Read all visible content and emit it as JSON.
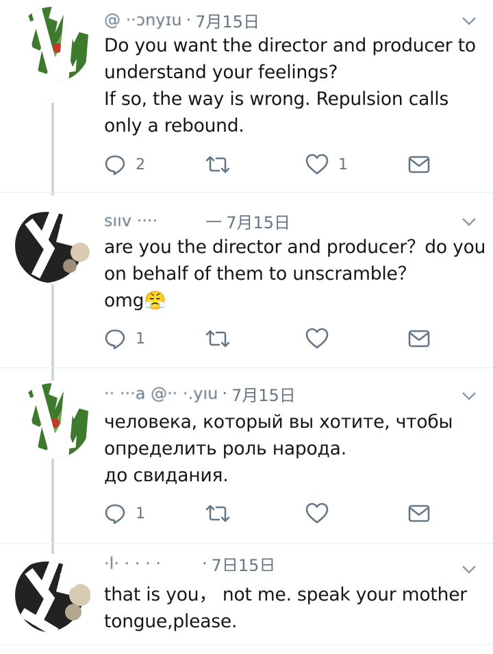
{
  "tweets": [
    {
      "handle": "@ ··ɔnyɪu",
      "date": "7月15日",
      "text": "Do you want the director and producer to understand your feelings?\nIf so, the way is wrong. Repulsion calls only a rebound.",
      "reply_count": "2",
      "retweet_count": "",
      "like_count": "1"
    },
    {
      "handle": "sııv ····",
      "date": "7月15日",
      "text": "are you the director and producer？do you on behalf of them to unscramble？\nomg😤",
      "reply_count": "1",
      "retweet_count": "",
      "like_count": ""
    },
    {
      "handle": "·· ···a @·· ·.yıu",
      "date": "7月15日",
      "text": "человека, который вы хотите, чтобы определить роль народа.\nдо свидания.",
      "reply_count": "1",
      "retweet_count": "",
      "like_count": ""
    },
    {
      "handle": "·l· · · · ·",
      "date": "7日15日",
      "text": "that is you，  not me. speak your mother tongue,please.",
      "reply_count": "",
      "retweet_count": "",
      "like_count": ""
    }
  ],
  "icons": {
    "reply": "reply-icon",
    "retweet": "retweet-icon",
    "like": "heart-icon",
    "dm": "envelope-icon",
    "more": "chevron-down-icon"
  },
  "colors": {
    "text": "#14171a",
    "meta": "#657786",
    "icon": "#657786",
    "thread_line": "#ccd6dd"
  }
}
